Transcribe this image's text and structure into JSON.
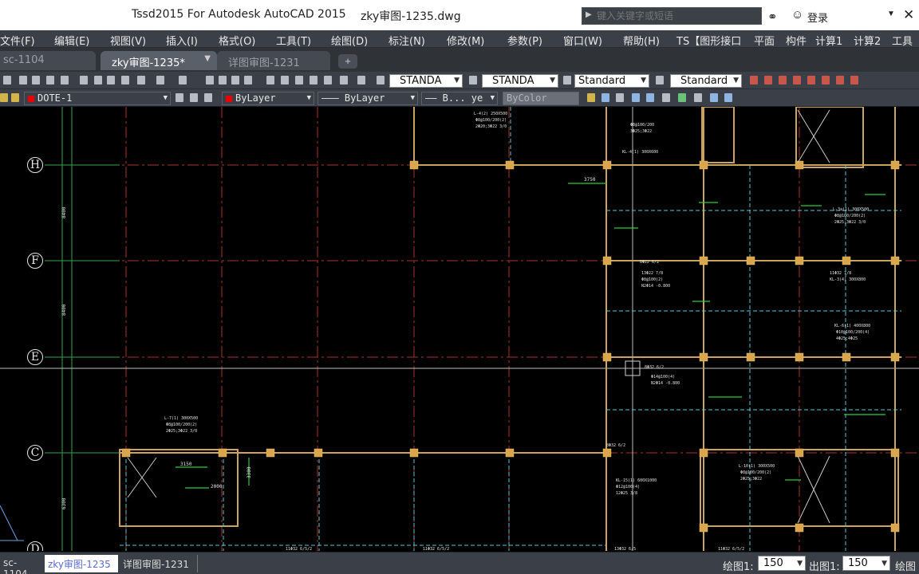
{
  "app": {
    "title": "Tssd2015 For Autodesk AutoCAD 2015",
    "filename": "zky审图-1235.dwg",
    "search_placeholder": "键入关键字或短语",
    "login_label": "登录"
  },
  "menu": [
    {
      "id": "file",
      "label": "文件(F)"
    },
    {
      "id": "edit",
      "label": "编辑(E)"
    },
    {
      "id": "view",
      "label": "视图(V)"
    },
    {
      "id": "insert",
      "label": "插入(I)"
    },
    {
      "id": "format",
      "label": "格式(O)"
    },
    {
      "id": "tools",
      "label": "工具(T)"
    },
    {
      "id": "draw",
      "label": "绘图(D)"
    },
    {
      "id": "dimension",
      "label": "标注(N)"
    },
    {
      "id": "modify",
      "label": "修改(M)"
    },
    {
      "id": "params",
      "label": "参数(P)"
    },
    {
      "id": "window",
      "label": "窗口(W)"
    },
    {
      "id": "help",
      "label": "帮助(H)"
    },
    {
      "id": "ts",
      "label": "TS【图形接口"
    },
    {
      "id": "plane",
      "label": "平面"
    },
    {
      "id": "member",
      "label": "构件"
    },
    {
      "id": "calc1",
      "label": "计算1"
    },
    {
      "id": "calc2",
      "label": "计算2"
    },
    {
      "id": "tools2",
      "label": "工具"
    }
  ],
  "doc_tabs": [
    {
      "label": "sc-1104",
      "active": false
    },
    {
      "label": "zky审图-1235*",
      "active": true
    },
    {
      "label": "详图审图-1231",
      "active": false
    }
  ],
  "toolbar1": {
    "text_style": "STANDA",
    "dim_style": "STANDA",
    "table_style": "Standard",
    "mleader_style": "Standard"
  },
  "toolbar2": {
    "layer": "DOTE-1",
    "color": "ByLayer",
    "linetype": "——— ByLayer",
    "lineweight": "—— B... ye",
    "plotstyle": "ByColor"
  },
  "axes": [
    {
      "id": "H",
      "label": "H"
    },
    {
      "id": "F",
      "label": "F"
    },
    {
      "id": "E",
      "label": "E"
    },
    {
      "id": "C",
      "label": "C"
    },
    {
      "id": "D",
      "label": "D"
    }
  ],
  "dims": {
    "d1": "8400",
    "d2": "8400",
    "d3": "3750",
    "d4": "6300",
    "d5": "3150",
    "d6": "2000",
    "d7": "3300"
  },
  "layout_tabs": [
    {
      "label": "sc-1104",
      "active": false
    },
    {
      "label": "zky审图-1235",
      "active": true
    },
    {
      "label": "详图审图-1231",
      "active": false
    }
  ],
  "status": {
    "draw_scale_label": "绘图1:",
    "draw_scale_value": "150",
    "out_scale_label": "出图1:",
    "out_scale_value": "150",
    "extra_label": "绘图"
  },
  "colors": {
    "accent_tab": "#5a6069",
    "beam": "#c9a45a",
    "column": "#d9a64e",
    "axis_red": "#c0392b",
    "rebar_green": "#2ecc40",
    "dim_cyan": "#58c4d8"
  }
}
